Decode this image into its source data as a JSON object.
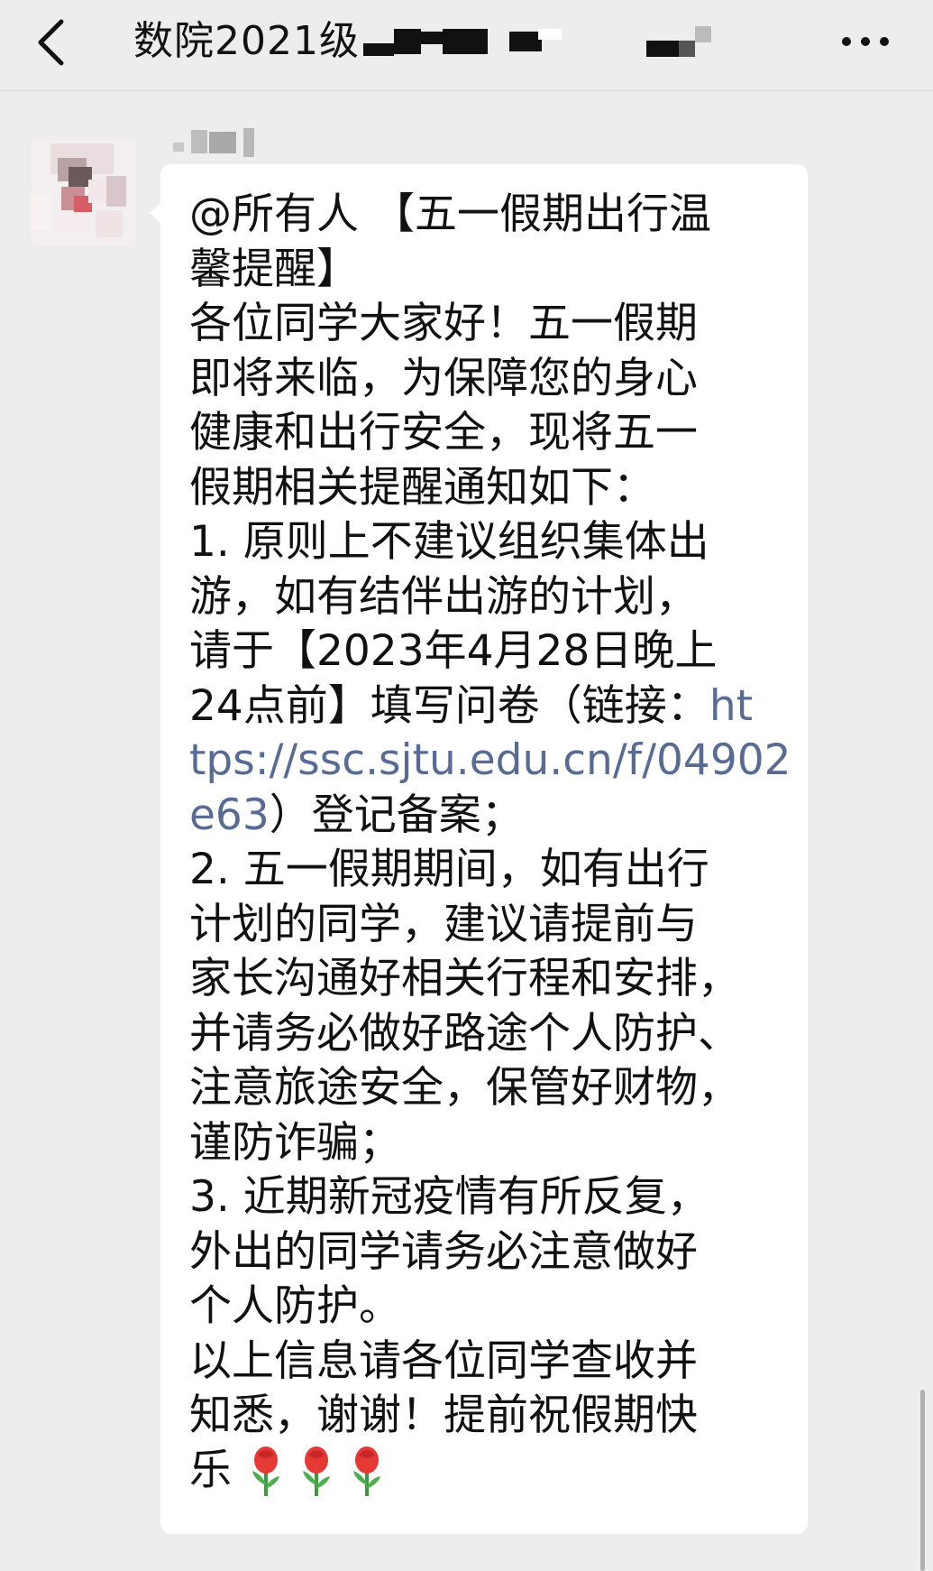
{
  "header": {
    "title": "数院2021级",
    "back_icon": "chevron-left-icon",
    "more_icon": "more-horizontal-icon"
  },
  "message": {
    "lines": [
      "@所有人 【五一假期出行温",
      "馨提醒】",
      "各位同学大家好！五一假期",
      "即将来临，为保障您的身心",
      "健康和出行安全，现将五一",
      "假期相关提醒通知如下：",
      "1. 原则上不建议组织集体出",
      "游，如有结伴出游的计划，",
      "请于【2023年4月28日晚上",
      "24点前】填写问卷（链接："
    ],
    "link_part1": "ht",
    "link_part2": "tps://ssc.sjtu.edu.cn/f/04902",
    "link_part3": "e63",
    "after_link": "）登记备案；",
    "lines2": [
      "2. 五一假期期间，如有出行",
      "计划的同学，建议请提前与",
      "家长沟通好相关行程和安排，",
      "并请务必做好路途个人防护、",
      "注意旅途安全，保管好财物，",
      "谨防诈骗；",
      "3. 近期新冠疫情有所反复，",
      "外出的同学请务必注意做好",
      "个人防护。",
      "以上信息请各位同学查收并",
      "知悉，谢谢！提前祝假期快"
    ],
    "last_line": "乐",
    "emoji_icon": "rose-icon"
  },
  "colors": {
    "background": "#ededed",
    "bubble": "#ffffff",
    "link": "#576b95"
  }
}
